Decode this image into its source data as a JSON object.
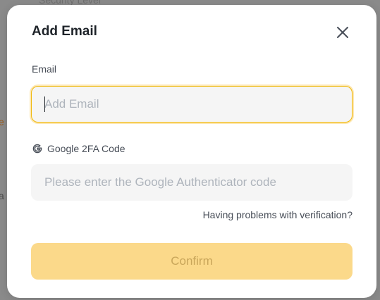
{
  "background": {
    "top_text": "Security Level",
    "left_text_1": "e",
    "left_text_2": "a"
  },
  "modal": {
    "title": "Add Email",
    "close_icon": "close-icon",
    "email": {
      "label": "Email",
      "placeholder": "Add Email",
      "value": ""
    },
    "google_2fa": {
      "icon": "google-icon",
      "label": "Google 2FA Code",
      "placeholder": "Please enter the Google Authenticator code",
      "value": ""
    },
    "help_link": "Having problems with verification?",
    "confirm_label": "Confirm"
  },
  "colors": {
    "accent": "#f0b90b",
    "confirm_disabled_bg": "#fbd98a",
    "input_bg": "#f5f5f5"
  }
}
